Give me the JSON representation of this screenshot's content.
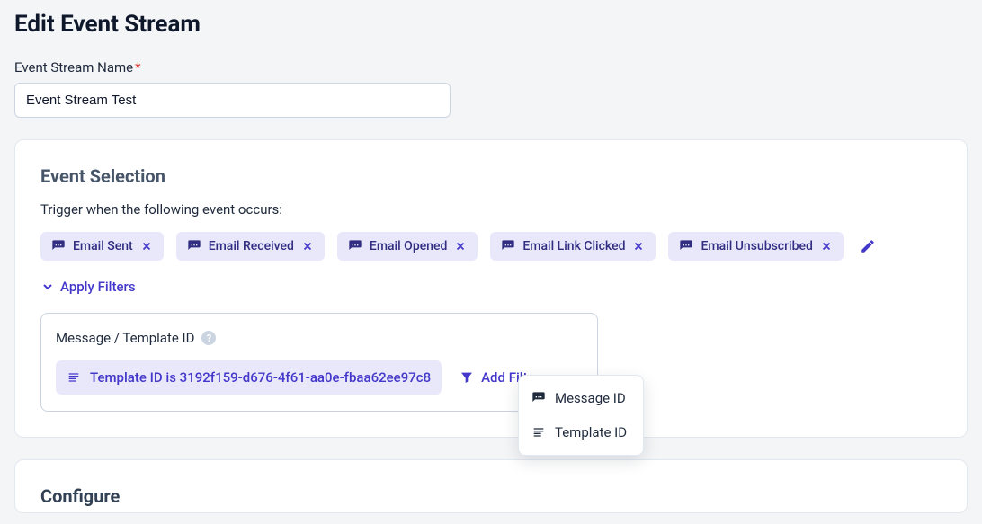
{
  "page": {
    "title": "Edit Event Stream"
  },
  "form": {
    "name_label": "Event Stream Name",
    "name_value": "Event Stream Test"
  },
  "event_selection": {
    "title": "Event Selection",
    "trigger_text": "Trigger when the following event occurs:",
    "chips": [
      {
        "label": "Email Sent"
      },
      {
        "label": "Email Received"
      },
      {
        "label": "Email Opened"
      },
      {
        "label": "Email Link Clicked"
      },
      {
        "label": "Email Unsubscribed"
      }
    ],
    "apply_filters_label": "Apply Filters",
    "filter": {
      "label": "Message / Template ID",
      "template_text": "Template ID is 3192f159-d676-4f61-aa0e-fbaa62ee97c8",
      "add_filter_label": "Add Filter"
    },
    "dropdown": {
      "items": [
        {
          "label": "Message ID",
          "icon": "message"
        },
        {
          "label": "Template ID",
          "icon": "lines"
        }
      ]
    }
  },
  "configure": {
    "title": "Configure"
  },
  "colors": {
    "accent": "#4338ca",
    "chip_bg": "#e9e8fb"
  }
}
